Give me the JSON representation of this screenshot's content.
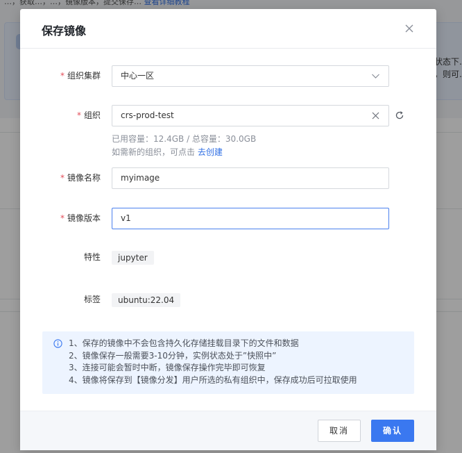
{
  "background": {
    "top_text": "…，获取…，…，镜像版本，提交保存…",
    "top_link": "查看详细教程",
    "side_text_1": "状态下…",
    "side_text_2": "，则可…"
  },
  "dialog": {
    "title": "保存镜像",
    "close_icon": "close-icon"
  },
  "form": {
    "required_mark": "*",
    "cluster": {
      "label": "组织集群",
      "value": "中心一区"
    },
    "org": {
      "label": "组织",
      "value": "crs-prod-test",
      "capacity_hint": "已用容量：12.4GB / 总容量：30.0GB",
      "create_hint": "如需新的组织，可点击",
      "create_link": "去创建"
    },
    "image_name": {
      "label": "镜像名称",
      "value": "myimage"
    },
    "image_version": {
      "label": "镜像版本",
      "value": "v1"
    },
    "feature": {
      "label": "特性",
      "tag": "jupyter"
    },
    "tags": {
      "label": "标签",
      "tag": "ubuntu:22.04"
    }
  },
  "notice": {
    "icon": "info-icon",
    "lines": [
      "1、保存的镜像中不会包含持久化存储挂载目录下的文件和数据",
      "2、镜像保存一般需要3-10分钟，实例状态处于”快照中”",
      "3、连接可能会暂时中断，镜像保存操作完毕即可恢复",
      "4、镜像将保存到【镜像分发】用户所选的私有组织中，保存成功后可拉取使用"
    ]
  },
  "footer": {
    "cancel_label": "取消",
    "ok_label": "确认"
  },
  "colors": {
    "primary": "#3a78f0",
    "required": "#e34d59",
    "notice_bg": "#edf4ff"
  }
}
